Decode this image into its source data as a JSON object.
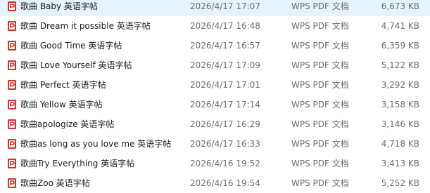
{
  "files": [
    {
      "name": "歌曲 Baby 英语字帖",
      "modified": "2026/4/17 17:07",
      "type": "WPS PDF 文档",
      "size": "6,673 KB",
      "icon": "pdf-file-icon"
    },
    {
      "name": "歌曲 Dream it possible 英语字帖",
      "modified": "2026/4/17 16:48",
      "type": "WPS PDF 文档",
      "size": "4,741 KB",
      "icon": "pdf-file-icon"
    },
    {
      "name": "歌曲 Good Time 英语字帖",
      "modified": "2026/4/17 16:57",
      "type": "WPS PDF 文档",
      "size": "6,359 KB",
      "icon": "pdf-file-icon"
    },
    {
      "name": "歌曲 Love Yourself 英语字帖",
      "modified": "2026/4/17 17:09",
      "type": "WPS PDF 文档",
      "size": "5,122 KB",
      "icon": "pdf-file-icon"
    },
    {
      "name": "歌曲 Perfect 英语字帖",
      "modified": "2026/4/17 17:01",
      "type": "WPS PDF 文档",
      "size": "3,292 KB",
      "icon": "pdf-file-icon"
    },
    {
      "name": "歌曲 Yellow 英语字帖",
      "modified": "2026/4/17 17:14",
      "type": "WPS PDF 文档",
      "size": "3,158 KB",
      "icon": "pdf-file-icon"
    },
    {
      "name": "歌曲apologize 英语字帖",
      "modified": "2026/4/17 16:29",
      "type": "WPS PDF 文档",
      "size": "3,146 KB",
      "icon": "pdf-file-icon"
    },
    {
      "name": "歌曲as long as you love me 英语字帖",
      "modified": "2026/4/17 16:33",
      "type": "WPS PDF 文档",
      "size": "4,718 KB",
      "icon": "pdf-file-icon"
    },
    {
      "name": "歌曲Try Everything 英语字帖",
      "modified": "2026/4/16 19:52",
      "type": "WPS PDF 文档",
      "size": "3,413 KB",
      "icon": "pdf-file-icon"
    },
    {
      "name": "歌曲Zoo 英语字帖",
      "modified": "2026/4/16 19:54",
      "type": "WPS PDF 文档",
      "size": "5,252 KB",
      "icon": "pdf-file-icon"
    }
  ],
  "colors": {
    "icon_red": "#d0342c",
    "icon_bg": "#ffffff",
    "text_primary": "#1a1a1a",
    "text_secondary": "#6d6d6d"
  }
}
